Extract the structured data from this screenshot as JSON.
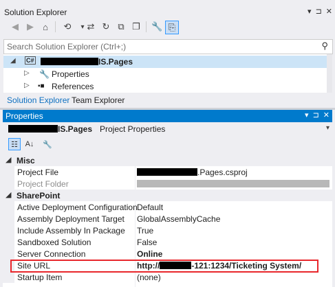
{
  "solution_explorer": {
    "title": "Solution Explorer",
    "title_controls": [
      "▾",
      "⊐",
      "✕"
    ],
    "toolbar_icons": [
      "back-icon",
      "forward-icon",
      "home-icon",
      "history-icon",
      "sync-icon",
      "refresh-icon",
      "collapse-all-icon",
      "show-all-files-icon",
      "properties-icon",
      "preview-icon"
    ],
    "search": {
      "placeholder": "Search Solution Explorer (Ctrl+;)"
    },
    "tree": {
      "project_label_visible": "IS.Pages",
      "project_badge": "C#",
      "items": [
        {
          "label": "Properties"
        },
        {
          "label": "References"
        }
      ]
    },
    "tabs": [
      "Solution Explorer",
      "Team Explorer"
    ]
  },
  "properties": {
    "title": "Properties",
    "title_controls": [
      "▾",
      "⊐",
      "✕"
    ],
    "object_name_visible": "IS.Pages",
    "object_type": "Project Properties",
    "categories": [
      {
        "name": "Misc",
        "rows": [
          {
            "name": "Project File",
            "value_visible": ".Pages.csproj"
          },
          {
            "name": "Project Folder",
            "value_visible": ""
          }
        ]
      },
      {
        "name": "SharePoint",
        "rows": [
          {
            "name": "Active Deployment Configuration",
            "value": "Default"
          },
          {
            "name": "Assembly Deployment Target",
            "value": "GlobalAssemblyCache"
          },
          {
            "name": "Include Assembly In Package",
            "value": "True"
          },
          {
            "name": "Sandboxed Solution",
            "value": "False"
          },
          {
            "name": "Server Connection",
            "value": "Online"
          },
          {
            "name": "Site URL",
            "value_prefix": "http://",
            "value_suffix": "-121:1234/Ticketing System/"
          },
          {
            "name": "Startup Item",
            "value": "(none)"
          }
        ]
      }
    ],
    "colors": {
      "title_bar": "#007acc",
      "highlight_border": "#e8262b"
    }
  }
}
